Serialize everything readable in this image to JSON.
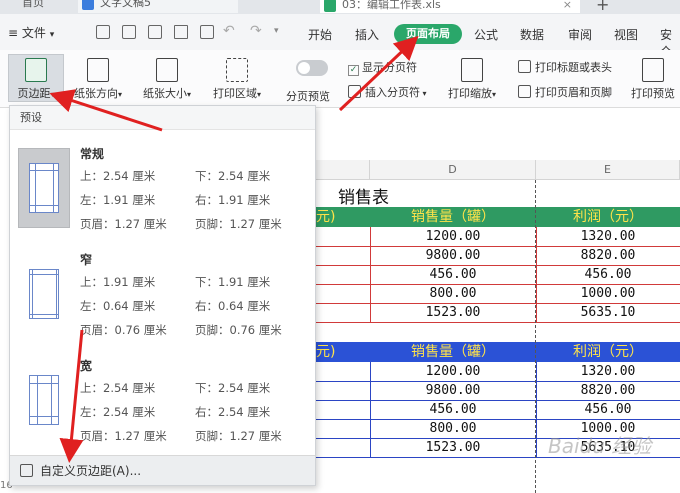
{
  "tabs": {
    "home": "首页",
    "doc": "文字文稿5",
    "xls": "03：编辑工作表.xls"
  },
  "menu": {
    "file": "文件",
    "start": "开始",
    "insert": "插入",
    "page_layout": "页面布局",
    "formula": "公式",
    "data": "数据",
    "review": "审阅",
    "view": "视图",
    "security": "安全"
  },
  "ribbon": {
    "margins": "页边距",
    "orientation": "纸张方向",
    "size": "纸张大小",
    "print_area": "打印区域",
    "page_break_preview": "分页预览",
    "show_page_break": "显示分页符",
    "insert_page_break": "插入分页符",
    "print_scale": "打印缩放",
    "print_titles": "打印标题或表头",
    "print_header_footer": "打印页眉和页脚",
    "print_preview": "打印预览"
  },
  "dropdown": {
    "header": "预设",
    "presets": [
      {
        "name": "常规",
        "top": "上：2.54 厘米",
        "bottom": "下：2.54 厘米",
        "left": "左：1.91 厘米",
        "right": "右：1.91 厘米",
        "header": "页眉：1.27 厘米",
        "footer": "页脚：1.27 厘米"
      },
      {
        "name": "窄",
        "top": "上：1.91 厘米",
        "bottom": "下：1.91 厘米",
        "left": "左：0.64 厘米",
        "right": "右：0.64 厘米",
        "header": "页眉：0.76 厘米",
        "footer": "页脚：0.76 厘米"
      },
      {
        "name": "宽",
        "top": "上：2.54 厘米",
        "bottom": "下：2.54 厘米",
        "left": "左：2.54 厘米",
        "right": "右：2.54 厘米",
        "header": "页眉：1.27 厘米",
        "footer": "页脚：1.27 厘米"
      }
    ],
    "custom": "自定义页边距(A)..."
  },
  "sheet": {
    "col_d": "D",
    "col_e": "E",
    "title": "销售表",
    "header_partial": "元)",
    "header_sales": "销售量（罐）",
    "header_profit": "利润（元）",
    "table1": [
      {
        "sales": "1200.00",
        "profit": "1320.00"
      },
      {
        "sales": "9800.00",
        "profit": "8820.00"
      },
      {
        "sales": "456.00",
        "profit": "456.00"
      },
      {
        "sales": "800.00",
        "profit": "1000.00"
      },
      {
        "sales": "1523.00",
        "profit": "5635.10"
      }
    ],
    "table2": [
      {
        "sales": "1200.00",
        "profit": "1320.00"
      },
      {
        "sales": "9800.00",
        "profit": "8820.00"
      },
      {
        "sales": "456.00",
        "profit": "456.00"
      },
      {
        "sales": "800.00",
        "profit": "1000.00"
      },
      {
        "sales": "1523.00",
        "profit": "5635.10"
      }
    ],
    "row_16": "16"
  },
  "watermark": "Baidu 经验",
  "colors": {
    "accent_green": "#2aa76a",
    "header_green": "#2f9a62",
    "header_blue": "#2b52d6",
    "header_text": "#ffe34a",
    "arrow_red": "#e02020"
  }
}
